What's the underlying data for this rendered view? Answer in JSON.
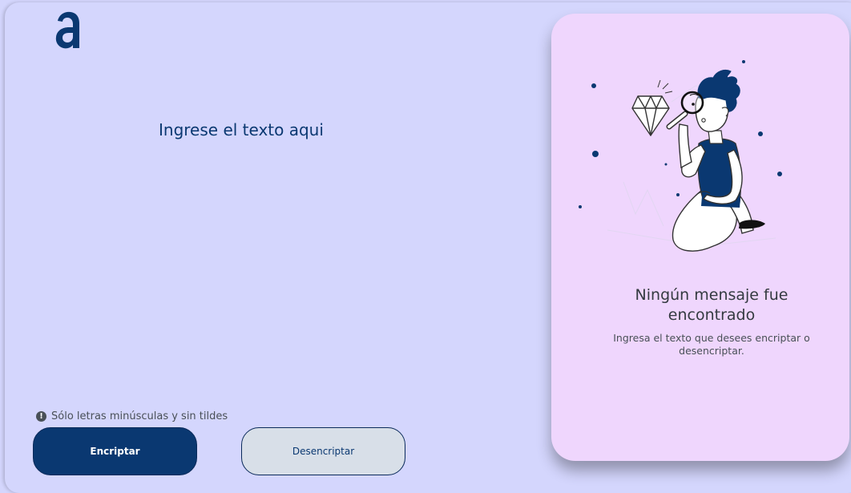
{
  "logo": {
    "icon": "alura-logo-icon",
    "color": "#0a3871"
  },
  "input": {
    "placeholder": "Ingrese el texto aqui",
    "value": ""
  },
  "hint": {
    "icon": "exclamation-circle-icon",
    "text": "Sólo letras minúsculas y sin tildes"
  },
  "buttons": {
    "encrypt_label": "Encriptar",
    "decrypt_label": "Desencriptar"
  },
  "result": {
    "illustration": "person-with-magnifier-illustration",
    "title": "Ningún mensaje fue encontrado",
    "text": "Ingresa el texto que desees encriptar o desencriptar."
  },
  "colors": {
    "background": "#d4d6fd",
    "card_background": "#efd6fd",
    "primary": "#0a3871",
    "secondary_button": "#d8dfe8"
  }
}
